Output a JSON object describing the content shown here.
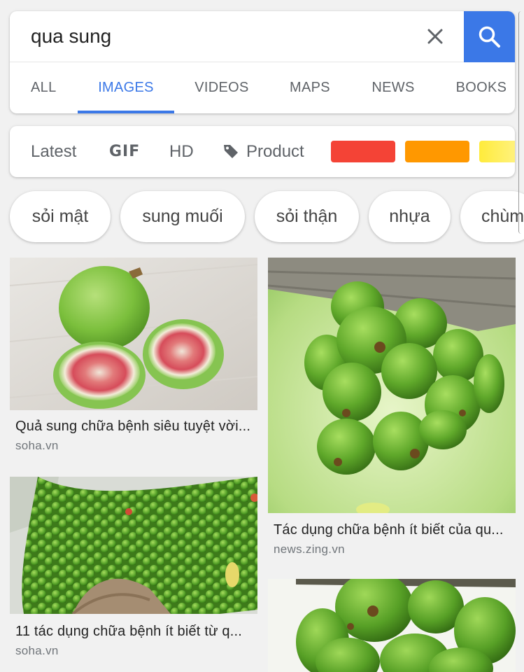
{
  "search": {
    "query": "qua sung",
    "clear_icon": "close-icon",
    "search_icon": "search-icon",
    "accent_color": "#3b78e7"
  },
  "tabs": [
    {
      "label": "ALL",
      "active": false
    },
    {
      "label": "IMAGES",
      "active": true
    },
    {
      "label": "VIDEOS",
      "active": false
    },
    {
      "label": "MAPS",
      "active": false
    },
    {
      "label": "NEWS",
      "active": false
    },
    {
      "label": "BOOKS",
      "active": false
    }
  ],
  "filters": {
    "latest": "Latest",
    "gif": "GIF",
    "hd": "HD",
    "product": "Product",
    "product_icon": "tag-icon",
    "colors": [
      "#f44336",
      "#ff9800",
      "#ffeb3b"
    ]
  },
  "chips": [
    "sỏi mật",
    "sung muối",
    "sỏi thận",
    "nhựa",
    "chùm"
  ],
  "results": [
    {
      "caption": "Quả sung chữa bệnh siêu tuyệt vời...",
      "source": "soha.vn",
      "image": "halved-fig-photo"
    },
    {
      "caption": "Tác dụng chữa bệnh ít biết của qu...",
      "source": "news.zing.vn",
      "image": "fig-cluster-photo"
    },
    {
      "caption": "11 tác dụng chữa bệnh ít biết từ q...",
      "source": "soha.vn",
      "image": "fig-tree-cluster-photo"
    },
    {
      "caption": "",
      "source": "",
      "image": "fig-closeup-photo"
    }
  ]
}
